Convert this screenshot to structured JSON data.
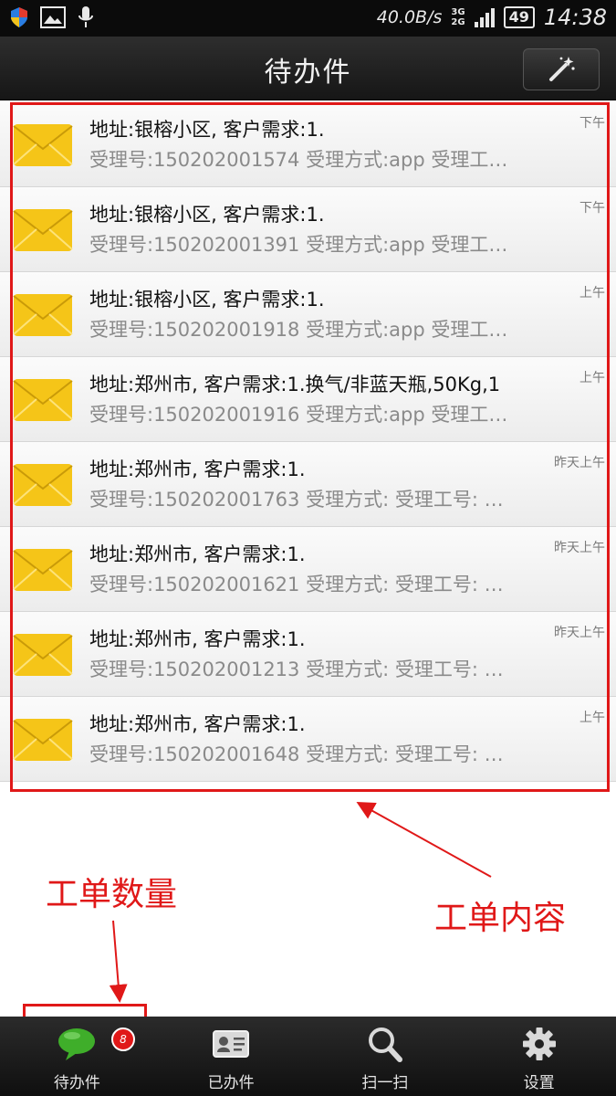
{
  "status_bar": {
    "net_speed": "40.0B/s",
    "net_type_top": "3G",
    "net_type_bottom": "2G",
    "battery": "49",
    "time": "14:38"
  },
  "header": {
    "title": "待办件"
  },
  "orders": [
    {
      "line1": "地址:银榕小区, 客户需求:1.",
      "line2": "受理号:150202001574  受理方式:app  受理工…",
      "time": "下午"
    },
    {
      "line1": "地址:银榕小区, 客户需求:1.",
      "line2": "受理号:150202001391  受理方式:app  受理工…",
      "time": "下午"
    },
    {
      "line1": "地址:银榕小区, 客户需求:1.",
      "line2": "受理号:150202001918  受理方式:app  受理工…",
      "time": "上午"
    },
    {
      "line1": "地址:郑州市, 客户需求:1.换气/非蓝天瓶,50Kg,1",
      "line2": "受理号:150202001916  受理方式:app  受理工…",
      "time": "上午"
    },
    {
      "line1": "地址:郑州市, 客户需求:1.",
      "line2": "受理号:150202001763  受理方式:  受理工号: …",
      "time": "昨天上午"
    },
    {
      "line1": "地址:郑州市, 客户需求:1.",
      "line2": "受理号:150202001621  受理方式:  受理工号: …",
      "time": "昨天上午"
    },
    {
      "line1": "地址:郑州市, 客户需求:1.",
      "line2": "受理号:150202001213  受理方式:  受理工号: …",
      "time": "昨天上午"
    },
    {
      "line1": "地址:郑州市, 客户需求:1.",
      "line2": "受理号:150202001648  受理方式:  受理工号: …",
      "time": "上午"
    }
  ],
  "annotations": {
    "count_label": "工单数量",
    "content_label": "工单内容"
  },
  "nav": {
    "items": [
      {
        "label": "待办件",
        "icon": "chat-bubble-icon",
        "badge": "8"
      },
      {
        "label": "已办件",
        "icon": "id-card-icon"
      },
      {
        "label": "扫一扫",
        "icon": "magnifier-icon"
      },
      {
        "label": "设置",
        "icon": "gear-icon"
      }
    ]
  },
  "colors": {
    "annotation": "#e01818",
    "bar": "#1a1a1a",
    "envelope": "#f5c518",
    "chat": "#3fae2a"
  }
}
